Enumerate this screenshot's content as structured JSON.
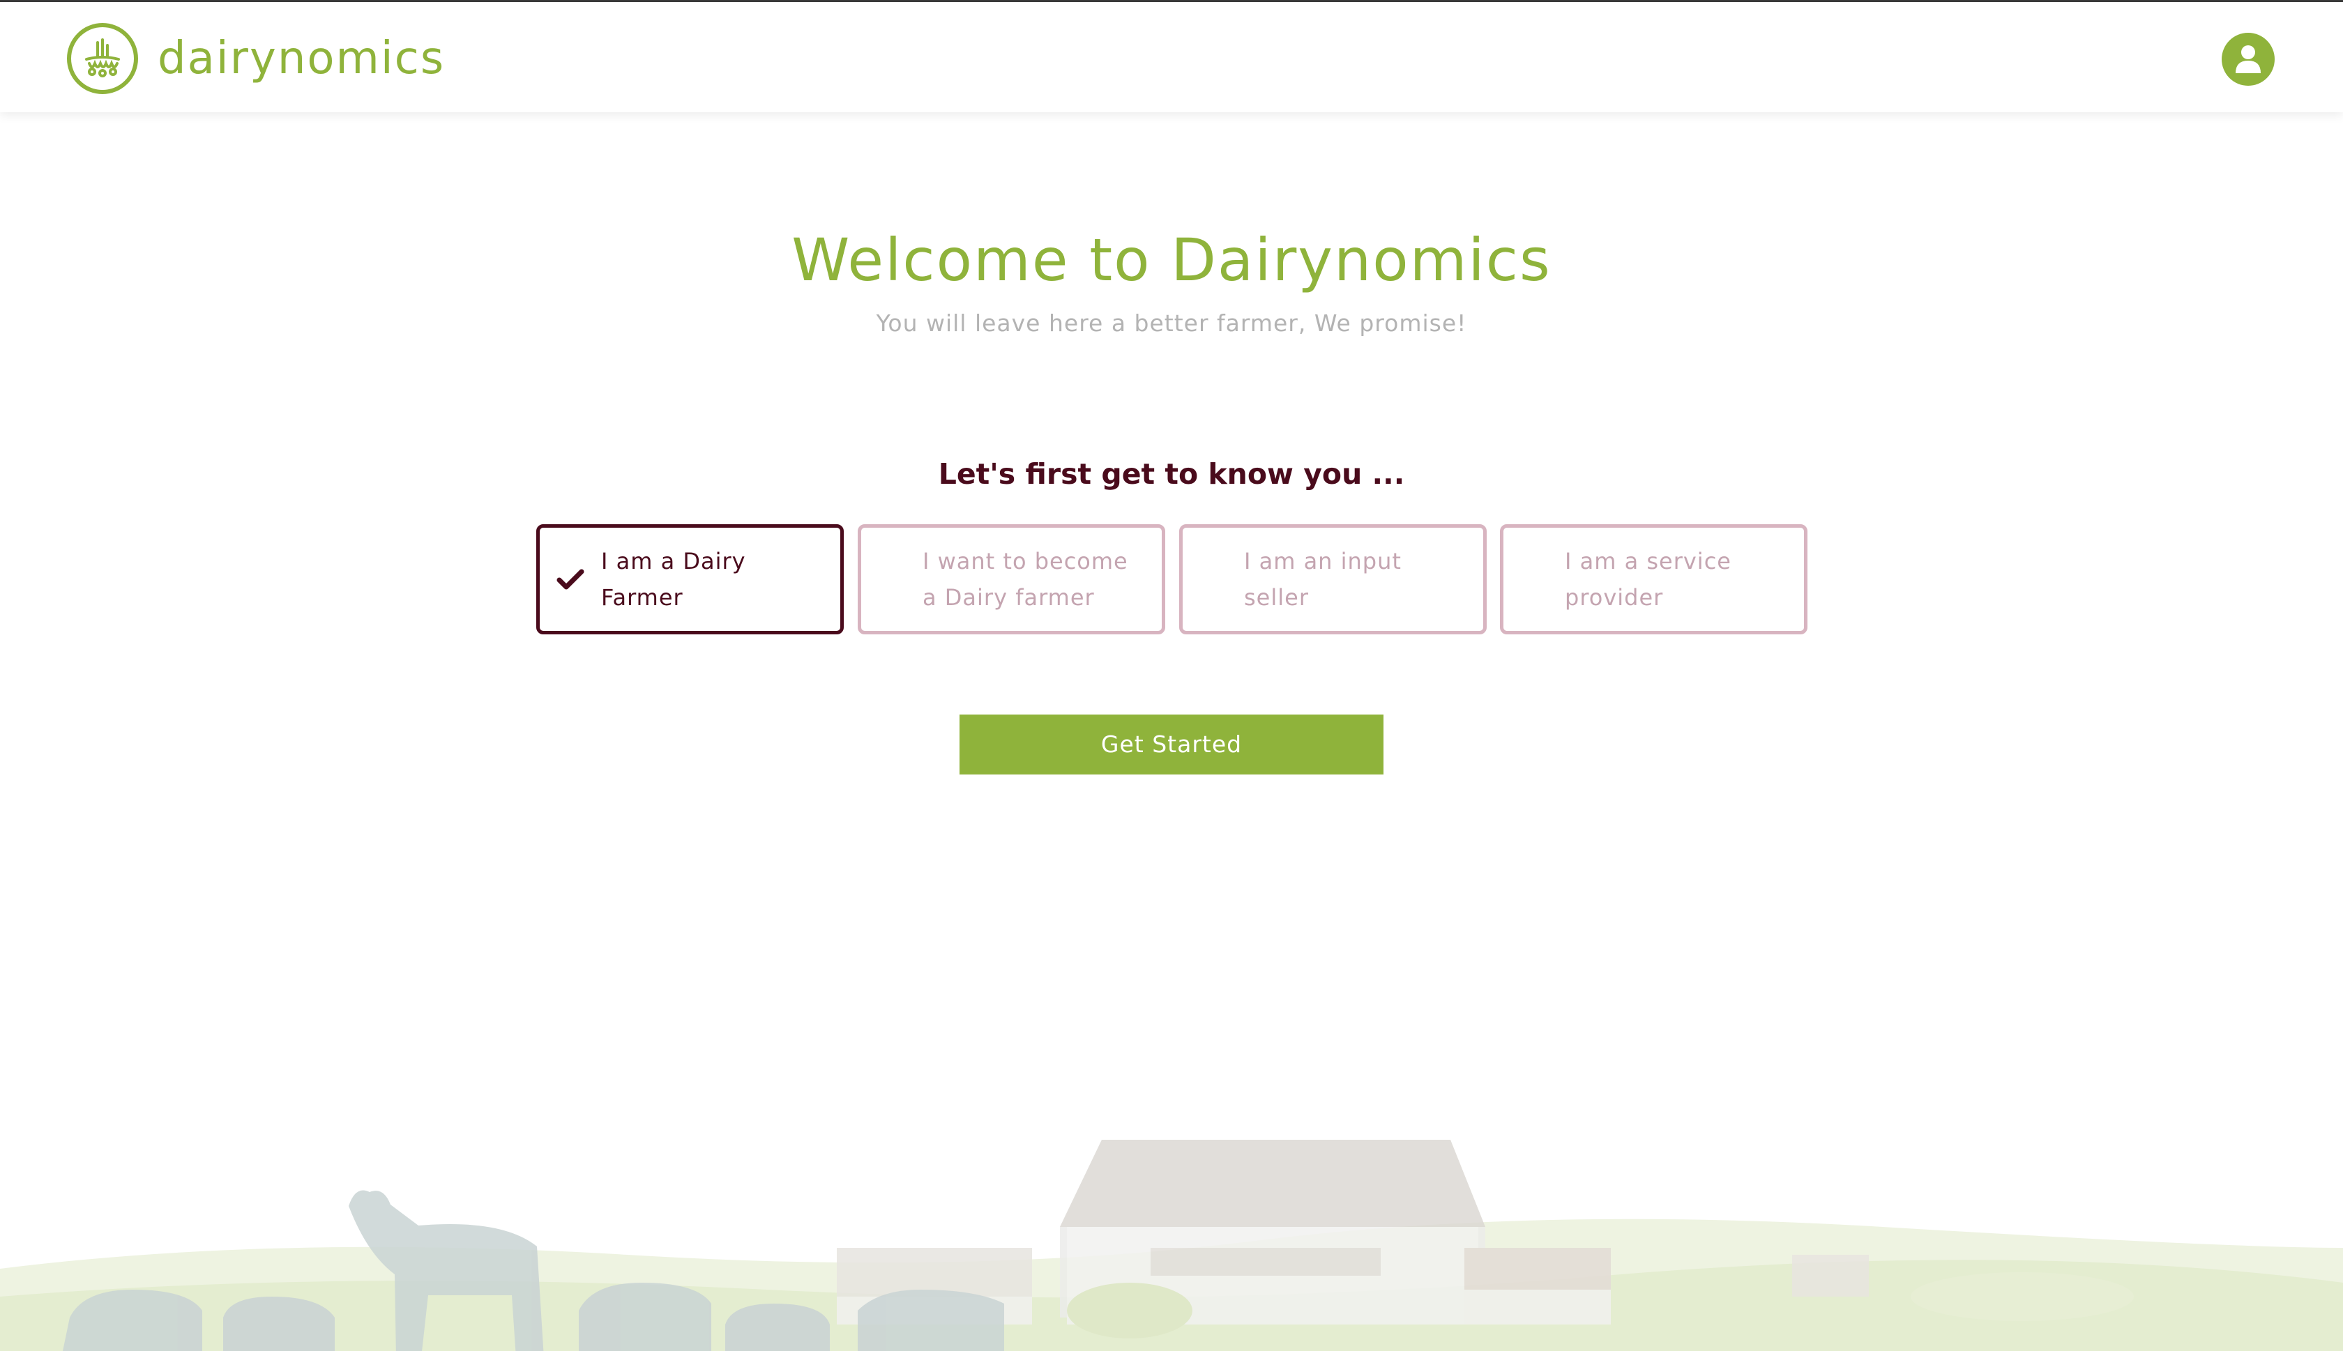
{
  "header": {
    "brand": "dairynomics",
    "logo_icon": "dairy-logo-icon",
    "profile_icon": "user-icon"
  },
  "main": {
    "title": "Welcome to Dairynomics",
    "subtitle": "You will leave here a better farmer, We promise!",
    "prompt": "Let's first get to know you ...",
    "options": [
      {
        "label": "I am a Dairy Farmer",
        "selected": true
      },
      {
        "label": "I want to become a Dairy farmer",
        "selected": false
      },
      {
        "label": "I am an input seller",
        "selected": false
      },
      {
        "label": "I am a service provider",
        "selected": false
      }
    ],
    "cta_label": "Get Started"
  },
  "colors": {
    "brand_green": "#8fb33b",
    "accent_maroon": "#4a0b1c",
    "option_border": "#d8b4c0",
    "muted_text": "#b3b3b3"
  }
}
